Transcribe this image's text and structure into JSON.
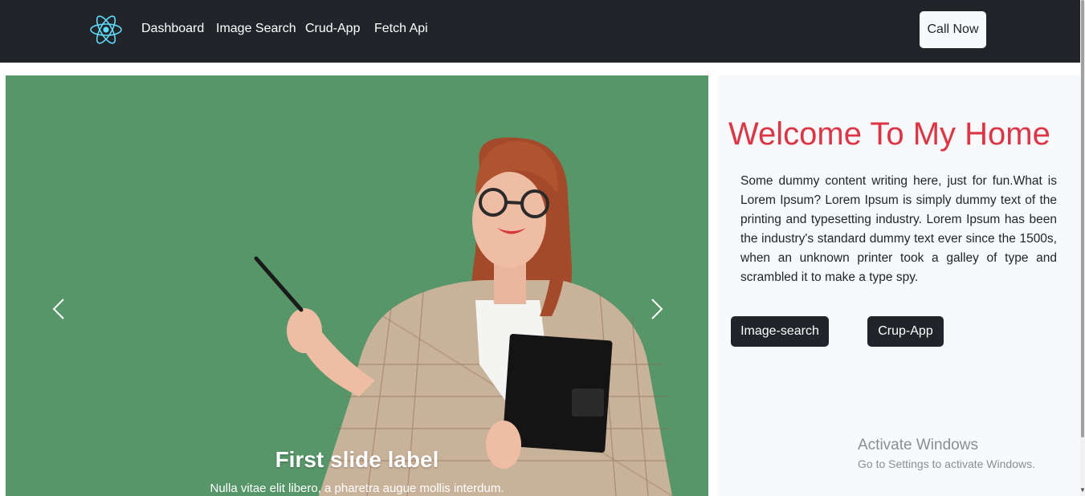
{
  "navbar": {
    "brand_icon": "react-logo-icon",
    "links": [
      "Dashboard",
      "Image Search",
      "Crud-App",
      "Fetch Api"
    ],
    "cta_label": "Call Now"
  },
  "carousel": {
    "slide_title": "First slide label",
    "slide_text": "Nulla vitae elit libero, a pharetra augue mollis interdum.",
    "prev_icon": "chevron-left-icon",
    "next_icon": "chevron-right-icon"
  },
  "hero": {
    "title": "Welcome To My Home",
    "body": "Some dummy content writing here, just for fun.What is Lorem Ipsum? Lorem Ipsum is simply dummy text of the printing and typesetting industry. Lorem Ipsum has been the industry's standard dummy text ever since the 1500s, when an unknown printer took a galley of type and scrambled it to make a type spy.",
    "buttons": [
      "Image-search",
      "Crup-App"
    ]
  },
  "watermark": {
    "title": "Activate Windows",
    "subtitle": "Go to Settings to activate Windows."
  },
  "colors": {
    "navbar_bg": "#212529",
    "accent_red": "#dc3545",
    "slide_bg": "#5a9a6c",
    "panel_bg": "#f8f9fa"
  }
}
